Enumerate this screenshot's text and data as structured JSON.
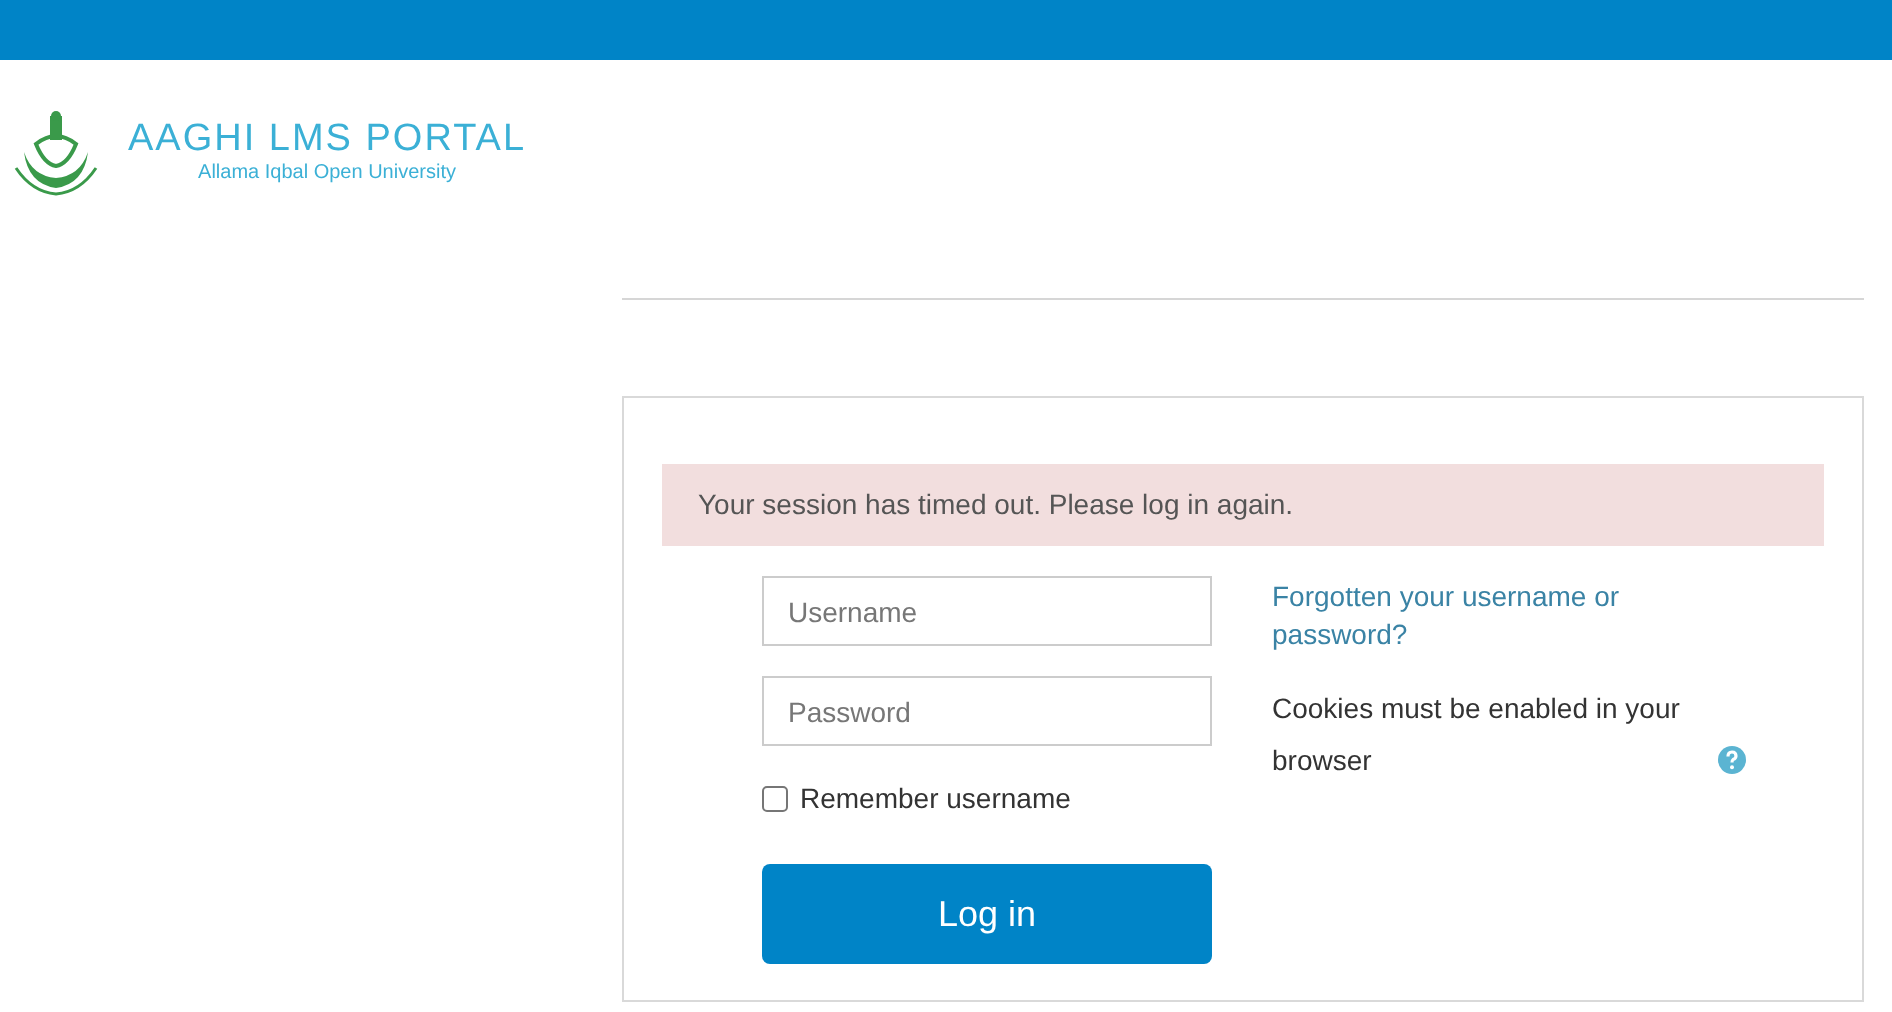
{
  "header": {
    "title": "AAGHI LMS PORTAL",
    "subtitle": "Allama Iqbal Open University"
  },
  "alert": {
    "message": "Your session has timed out. Please log in again."
  },
  "form": {
    "username": {
      "placeholder": "Username"
    },
    "password": {
      "placeholder": "Password"
    },
    "remember": {
      "label": "Remember username",
      "checked": false
    },
    "submit": "Log in"
  },
  "help": {
    "forgot_link": "Forgotten your username or password?",
    "cookies_note": "Cookies must be enabled in your browser"
  }
}
